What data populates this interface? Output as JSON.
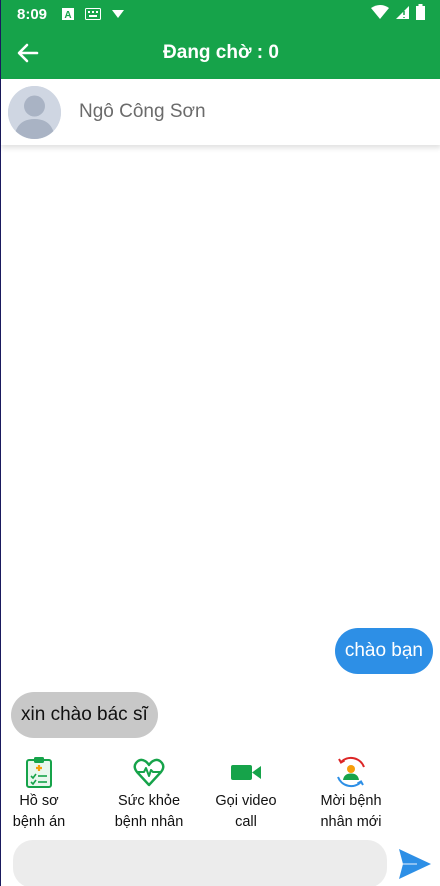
{
  "status_bar": {
    "time": "8:09"
  },
  "header": {
    "title": "Đang chờ : 0"
  },
  "contact": {
    "name": "Ngô Công Sơn"
  },
  "messages": [
    {
      "direction": "outgoing",
      "text": "chào bạn"
    },
    {
      "direction": "incoming",
      "text": "xin chào bác sĩ"
    }
  ],
  "actions": [
    {
      "icon": "medical-record-icon",
      "label": "Hồ sơ\nbệnh án"
    },
    {
      "icon": "heart-pulse-icon",
      "label": "Sức khỏe\nbệnh nhân"
    },
    {
      "icon": "video-camera-icon",
      "label": "Gọi video\ncall"
    },
    {
      "icon": "invite-user-icon",
      "label": "Mời bệnh\nnhân mới"
    }
  ],
  "composer": {
    "placeholder": ""
  },
  "colors": {
    "primary": "#16a34a",
    "outgoing_bubble": "#2d8fe6",
    "incoming_bubble": "#c8c8c8",
    "send": "#2d8fe6"
  }
}
